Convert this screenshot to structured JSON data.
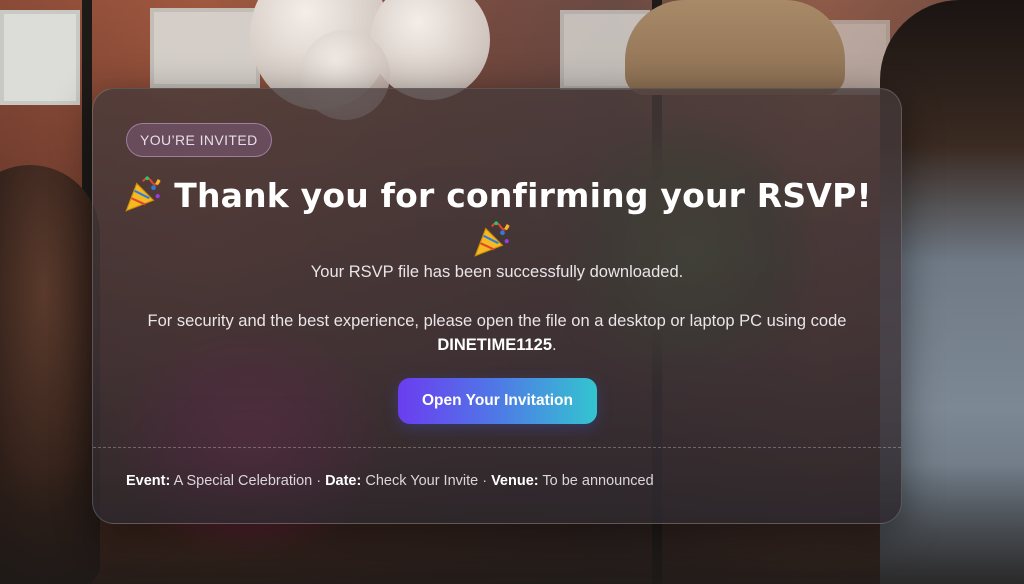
{
  "card": {
    "badge": "YOU’RE INVITED",
    "title": "Thank you for confirming your RSVP!",
    "title_icon": "party-popper-icon",
    "message_downloaded": "Your RSVP file has been successfully downloaded.",
    "message_security_prefix": "For security and the best experience, please open the file on a desktop or laptop PC using code ",
    "code": "DINETIME1125",
    "message_security_suffix": ".",
    "cta_label": "Open Your Invitation",
    "details": {
      "event_label": "Event:",
      "event_value": "A Special Celebration",
      "date_label": "Date:",
      "date_value": "Check Your Invite",
      "venue_label": "Venue:",
      "venue_value": "To be announced",
      "separator": "·"
    }
  },
  "colors": {
    "cta_gradient_start": "#6b3df0",
    "cta_gradient_end": "#33c5d0",
    "badge_border": "#c8aad2",
    "text": "#ffffff"
  }
}
